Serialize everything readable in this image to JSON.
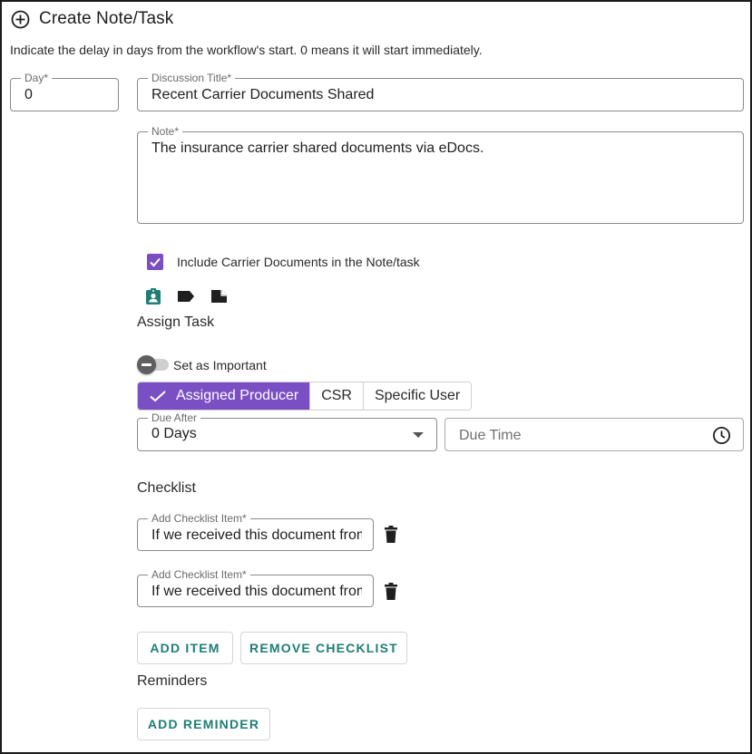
{
  "header": {
    "title": "Create Note/Task",
    "subtitle": "Indicate the delay in days from the workflow's start. 0 means it will start immediately.",
    "icon": "add-circle-icon"
  },
  "form": {
    "day": {
      "label": "Day*",
      "value": "0"
    },
    "discussion_title": {
      "label": "Discussion Title*",
      "value": "Recent Carrier Documents Shared"
    },
    "note": {
      "label": "Note*",
      "value": "The insurance carrier shared documents via eDocs."
    },
    "include_carrier_docs": {
      "label": "Include Carrier Documents in the Note/task",
      "checked": true
    },
    "toolbar_icons": [
      "assignment-ind-icon",
      "label-icon",
      "sticky-note-icon"
    ]
  },
  "assign": {
    "title": "Assign Task",
    "important": {
      "label": "Set as Important",
      "on": false
    },
    "options": [
      "Assigned Producer",
      "CSR",
      "Specific User"
    ],
    "selected": "Assigned Producer",
    "due_after": {
      "label": "Due After",
      "value": "0 Days"
    },
    "due_time": {
      "placeholder": "Due Time"
    }
  },
  "checklist": {
    "title": "Checklist",
    "items": [
      {
        "label": "Add Checklist Item*",
        "value": "If we received this document from"
      },
      {
        "label": "Add Checklist Item*",
        "value": "If we received this document from"
      }
    ],
    "add_item_label": "ADD ITEM",
    "remove_label": "REMOVE CHECKLIST"
  },
  "reminders": {
    "title": "Reminders",
    "add_label": "ADD REMINDER"
  },
  "colors": {
    "accent": "#7a4fc4",
    "button_text": "#1d7e74",
    "icon_teal": "#1d7e74"
  }
}
